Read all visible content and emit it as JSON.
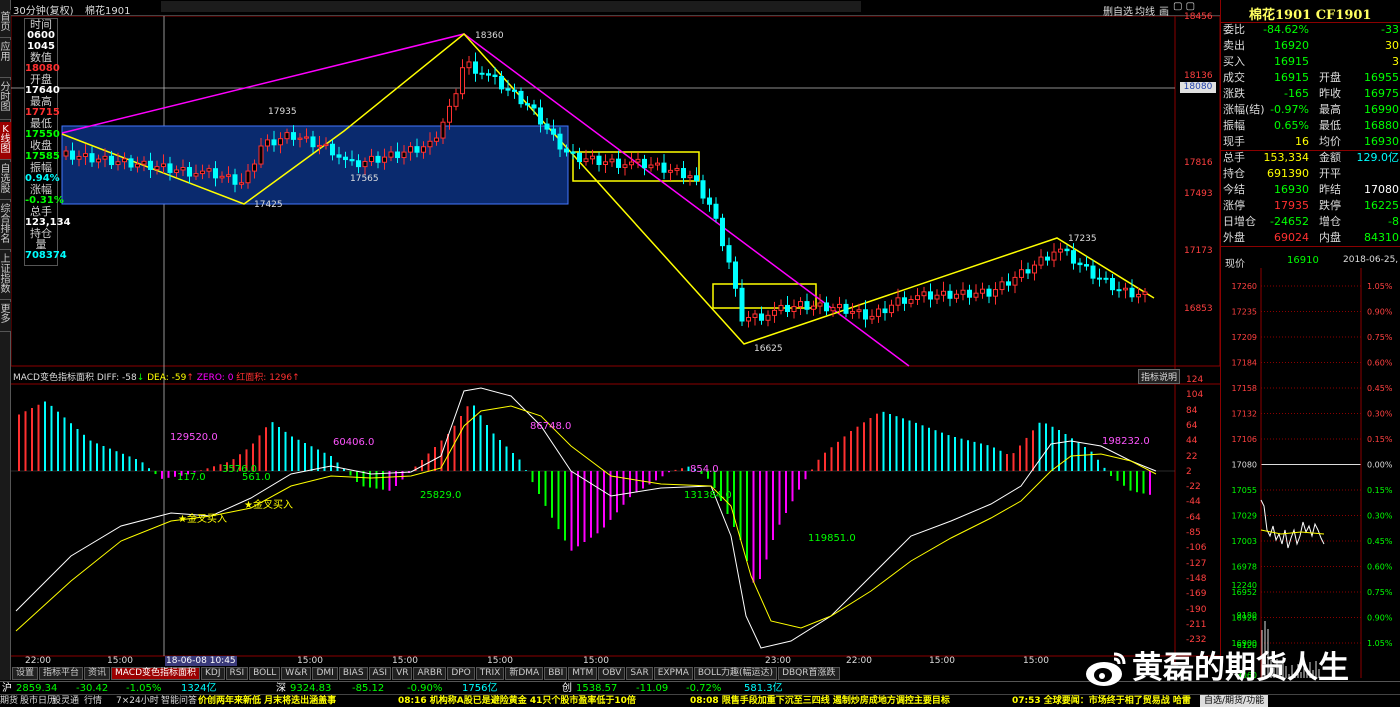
{
  "top_bar": {
    "period": "30分钟(复权)",
    "symbol_short": "棉花1901",
    "right_labels": [
      "删自选",
      "均线",
      "画"
    ]
  },
  "left_tabs": [
    "首页",
    "应用",
    "分时图",
    "K线图",
    "自选股",
    "综合排名",
    "上证指数",
    "更多"
  ],
  "info_box": {
    "items": [
      {
        "label": "时间",
        "value": "0600",
        "color": "#ffffff"
      },
      {
        "label": "",
        "value": "1045",
        "color": "#ffffff"
      },
      {
        "label": "数值",
        "value": "18080",
        "color": "#ff3030"
      },
      {
        "label": "开盘",
        "value": "17640",
        "color": "#ffffff"
      },
      {
        "label": "最高",
        "value": "17715",
        "color": "#ff3030"
      },
      {
        "label": "最低",
        "value": "17550",
        "color": "#00ff00"
      },
      {
        "label": "收盘",
        "value": "17585",
        "color": "#00ff00"
      },
      {
        "label": "振幅",
        "value": "0.94%",
        "color": "#00ffff"
      },
      {
        "label": "涨幅",
        "value": "-0.31%",
        "color": "#00ff00"
      },
      {
        "label": "总手",
        "value": "123,134",
        "color": "#ffffff"
      },
      {
        "label": "持仓量",
        "value": "708374",
        "color": "#00ffff"
      }
    ]
  },
  "price_axis": [
    "18456",
    "18136",
    "17816",
    "17493",
    "17173",
    "16853"
  ],
  "price_marker": "18080",
  "annotations": {
    "high": "18360",
    "p17935": "17935",
    "p17565": "17565",
    "p17425": "17425",
    "p16625": "16625",
    "p17235": "17235"
  },
  "macd": {
    "header": {
      "name": "MACD变色指标面积",
      "diff": "DIFF: -58",
      "dea": "DEA: -59",
      "zero": "ZERO: 0",
      "area": "红面积: 1296"
    },
    "button": "指标说明",
    "axis": [
      "124",
      "104",
      "84",
      "64",
      "44",
      "22",
      "2",
      "-22",
      "-44",
      "-64",
      "-85",
      "-106",
      "-127",
      "-148",
      "-169",
      "-190",
      "-211",
      "-232"
    ],
    "area_labels": [
      "129520.0",
      "3576.0",
      "60406.0",
      "86748.0",
      "854.0",
      "198232.0",
      "117.0",
      "561.0",
      "25829.0",
      "131384.0",
      "119851.0"
    ],
    "cross_labels": [
      "金叉买入",
      "金叉买入"
    ]
  },
  "time_axis": [
    "22:00",
    "15:00",
    "18-06-08 10:45",
    "15:00",
    "15:00",
    "15:00",
    "15:00",
    "23:00",
    "22:00",
    "15:00",
    "15:00"
  ],
  "bottom_tabs": [
    "设置",
    "指标平台",
    "资讯",
    "MACD变色指标面积",
    "KDJ",
    "RSI",
    "BOLL",
    "W&R",
    "DMI",
    "BIAS",
    "ASI",
    "VR",
    "ARBR",
    "DPO",
    "TRIX",
    "新DMA",
    "BBI",
    "MTM",
    "OBV",
    "SAR",
    "EXPMA",
    "BOLL力趣(幅运达)",
    "DBQR首涨跌"
  ],
  "quote": {
    "title": "棉花1901 CF1901",
    "rows": [
      [
        {
          "t": "委比",
          "c": "#ddd"
        },
        {
          "t": "-84.62%",
          "c": "#00ff00"
        },
        {
          "t": "",
          "c": "#ddd"
        },
        {
          "t": "-33",
          "c": "#00ff00"
        }
      ],
      [
        {
          "t": "卖出",
          "c": "#ddd"
        },
        {
          "t": "16920",
          "c": "#00ff00"
        },
        {
          "t": "",
          "c": "#ddd"
        },
        {
          "t": "30",
          "c": "#ffff00"
        }
      ],
      [
        {
          "t": "买入",
          "c": "#ddd"
        },
        {
          "t": "16915",
          "c": "#00ff00"
        },
        {
          "t": "",
          "c": "#ddd"
        },
        {
          "t": "3",
          "c": "#ffff00"
        }
      ],
      [
        {
          "t": "成交",
          "c": "#ddd"
        },
        {
          "t": "16915",
          "c": "#00ff00"
        },
        {
          "t": "开盘",
          "c": "#ddd"
        },
        {
          "t": "16955",
          "c": "#00ff00"
        }
      ],
      [
        {
          "t": "涨跌",
          "c": "#ddd"
        },
        {
          "t": "-165",
          "c": "#00ff00"
        },
        {
          "t": "昨收",
          "c": "#ddd"
        },
        {
          "t": "16975",
          "c": "#00ff00"
        }
      ],
      [
        {
          "t": "涨幅(结)",
          "c": "#ddd"
        },
        {
          "t": "-0.97%",
          "c": "#00ff00"
        },
        {
          "t": "最高",
          "c": "#ddd"
        },
        {
          "t": "16990",
          "c": "#00ff00"
        }
      ],
      [
        {
          "t": "振幅",
          "c": "#ddd"
        },
        {
          "t": "0.65%",
          "c": "#00ff00"
        },
        {
          "t": "最低",
          "c": "#ddd"
        },
        {
          "t": "16880",
          "c": "#00ff00"
        }
      ],
      [
        {
          "t": "现手",
          "c": "#ddd"
        },
        {
          "t": "16",
          "c": "#ffff00"
        },
        {
          "t": "均价",
          "c": "#ddd"
        },
        {
          "t": "16930",
          "c": "#00ff00"
        }
      ],
      [
        {
          "t": "总手",
          "c": "#ddd"
        },
        {
          "t": "153,334",
          "c": "#ffff00"
        },
        {
          "t": "金额",
          "c": "#ddd"
        },
        {
          "t": "129.0亿",
          "c": "#00ffff"
        }
      ],
      [
        {
          "t": "持仓",
          "c": "#ddd"
        },
        {
          "t": "691390",
          "c": "#ffff00"
        },
        {
          "t": "开平",
          "c": "#ddd"
        },
        {
          "t": "",
          "c": "#ddd"
        }
      ],
      [
        {
          "t": "今结",
          "c": "#ddd"
        },
        {
          "t": "16930",
          "c": "#00ff00"
        },
        {
          "t": "昨结",
          "c": "#ddd"
        },
        {
          "t": "17080",
          "c": "#ffffff"
        }
      ],
      [
        {
          "t": "涨停",
          "c": "#ddd"
        },
        {
          "t": "17935",
          "c": "#ff3030"
        },
        {
          "t": "跌停",
          "c": "#ddd"
        },
        {
          "t": "16225",
          "c": "#00ff00"
        }
      ],
      [
        {
          "t": "日增仓",
          "c": "#ddd"
        },
        {
          "t": "-24652",
          "c": "#00ff00"
        },
        {
          "t": "增仓",
          "c": "#ddd"
        },
        {
          "t": "-8",
          "c": "#00ff00"
        }
      ],
      [
        {
          "t": "外盘",
          "c": "#ddd"
        },
        {
          "t": "69024",
          "c": "#ff3030"
        },
        {
          "t": "内盘",
          "c": "#ddd"
        },
        {
          "t": "84310",
          "c": "#00ff00"
        }
      ]
    ]
  },
  "mini_chart": {
    "label_now": "现价",
    "now": "16910",
    "date": "2018-06-25,",
    "left_axis": [
      "17260",
      "17235",
      "17209",
      "17184",
      "17158",
      "17132",
      "17106",
      "17080",
      "17055",
      "17029",
      "17003",
      "16978",
      "16952",
      "16926",
      "16900",
      "12240",
      "9180",
      "6120",
      "3060"
    ],
    "right_axis": [
      "1.05%",
      "0.90%",
      "0.75%",
      "0.60%",
      "0.45%",
      "0.30%",
      "0.15%",
      "0.00%",
      "0.15%",
      "0.30%",
      "0.45%",
      "0.60%",
      "0.75%",
      "0.90%",
      "1.05%"
    ]
  },
  "status1": {
    "segments": [
      {
        "t": "沪",
        "c": "#ffffff"
      },
      {
        "t": "2859.34",
        "c": "#00ff00"
      },
      {
        "t": "-30.42",
        "c": "#00ff00"
      },
      {
        "t": "-1.05%",
        "c": "#00ff00"
      },
      {
        "t": "1324亿",
        "c": "#00ffff"
      },
      {
        "t": "深",
        "c": "#ffffff"
      },
      {
        "t": "9324.83",
        "c": "#00ff00"
      },
      {
        "t": "-85.12",
        "c": "#00ff00"
      },
      {
        "t": "-0.90%",
        "c": "#00ff00"
      },
      {
        "t": "1756亿",
        "c": "#00ffff"
      },
      {
        "t": "创",
        "c": "#ffffff"
      },
      {
        "t": "1538.57",
        "c": "#00ff00"
      },
      {
        "t": "-11.09",
        "c": "#00ff00"
      },
      {
        "t": "-0.72%",
        "c": "#00ff00"
      },
      {
        "t": "581.3亿",
        "c": "#00ffff"
      }
    ]
  },
  "status2": {
    "items": [
      "期货",
      "股市日历",
      "股灵通",
      "行情",
      "7×24小时",
      "智能问答"
    ],
    "news": [
      "价创两年来新低 月末将迭出涵盖事",
      "08:16 机构称A股已是避险黄金 41只个股市盈率低于10倍",
      "08:08 限售手段加重下沉至三四线 遏制炒房成地方调控主要目标",
      "07:53 全球要闻：市场终于相了贸易战 哈雷"
    ],
    "right_box": "自选/期货/功能"
  },
  "watermark": "黄磊的期货人生"
}
